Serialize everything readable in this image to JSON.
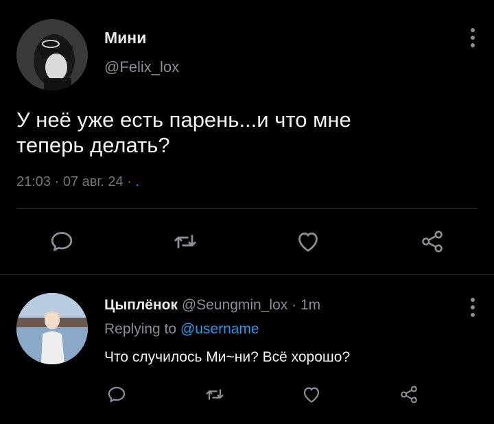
{
  "main_tweet": {
    "display_name": "Мини",
    "handle": "@Felix_lox",
    "text_line1": "У неё уже есть парень...и что мне",
    "text_line2": "теперь делать?",
    "time": "21:03",
    "date": "07 авг. 24",
    "sep": "·",
    "trailing": "."
  },
  "reply_tweet": {
    "display_name": "Цыплёнок",
    "handle": "@Seungmin_lox",
    "sep": "·",
    "age": "1m",
    "replying_prefix": "Replying to",
    "replying_user": "@username",
    "text": "Что случилось Ми~ни? Всё хорошо?"
  },
  "icons": {
    "reply": "comment-bubble-icon",
    "retweet": "retweet-icon",
    "like": "heart-icon",
    "share": "share-icon",
    "more": "more-vertical-icon"
  },
  "colors": {
    "background": "#000000",
    "text": "#e7e9ea",
    "muted": "#8b8f94",
    "accent": "#1d9bf0",
    "divider": "#2f3336"
  }
}
